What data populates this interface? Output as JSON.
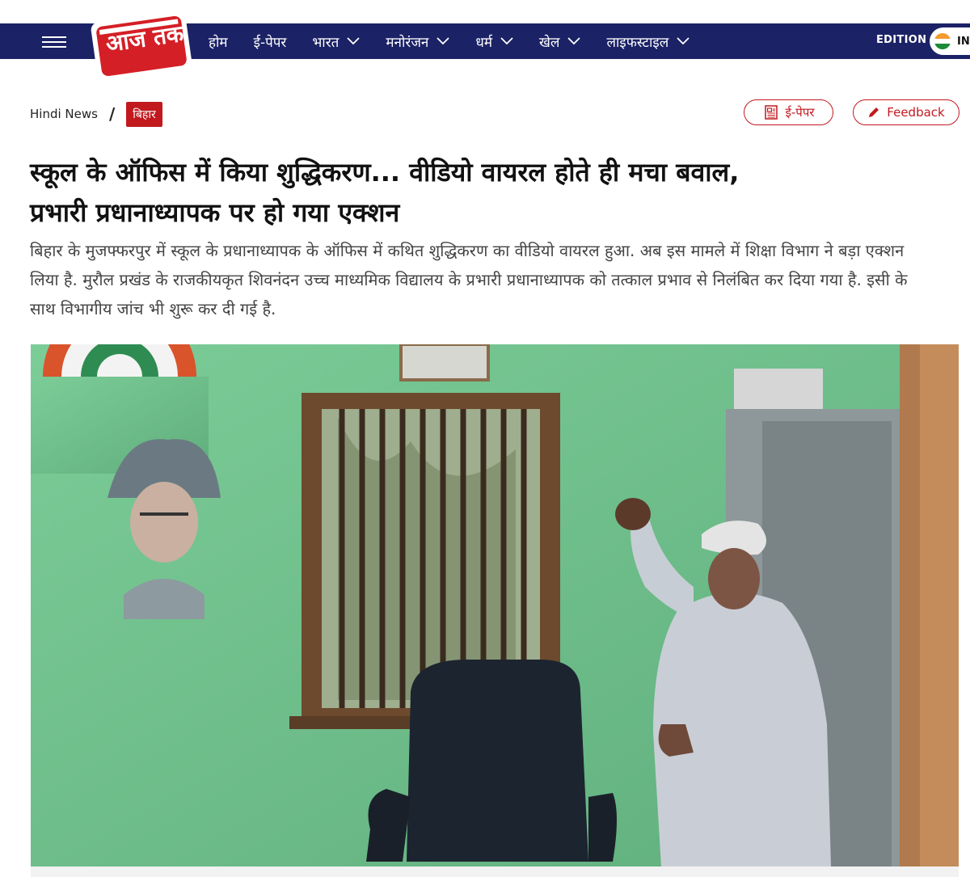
{
  "header": {
    "logo_text": "आज तक",
    "nav": [
      {
        "label": "होम",
        "has_menu": false
      },
      {
        "label": "ई-पेपर",
        "has_menu": false
      },
      {
        "label": "भारत",
        "has_menu": true
      },
      {
        "label": "मनोरंजन",
        "has_menu": true
      },
      {
        "label": "धर्म",
        "has_menu": true
      },
      {
        "label": "खेल",
        "has_menu": true
      },
      {
        "label": "लाइफस्टाइल",
        "has_menu": true
      }
    ],
    "edition_label": "EDITION",
    "edition_code": "IN",
    "colors": {
      "bar": "#1b2266",
      "accent": "#c2191f"
    }
  },
  "breadcrumb": {
    "home": "Hindi News",
    "separator": "/",
    "section": "बिहार"
  },
  "actions": {
    "epaper_label": "ई-पेपर",
    "feedback_label": "Feedback"
  },
  "article": {
    "headline_line1": "स्कूल के ऑफिस में किया शुद्धिकरण... वीडियो वायरल होते ही मचा बवाल,",
    "headline_line2": "प्रभारी प्रधानाध्यापक पर हो गया एक्शन",
    "summary": "बिहार के मुजफ्फरपुर में स्कूल के प्रधानाध्यापक के ऑफिस में कथित शुद्धिकरण का वीडियो वायरल हुआ. अब इस मामले में शिक्षा विभाग ने बड़ा एक्शन लिया है. मुरौल प्रखंड के राजकीयकृत शिवनंदन उच्च माध्यमिक विद्यालय के प्रभारी प्रधानाध्यापक को तत्काल प्रभाव से निलंबित कर दिया गया है. इसी के साथ विभागीय जांच भी शुरू कर दी गई है.",
    "hero_image": "office-room-scene"
  }
}
